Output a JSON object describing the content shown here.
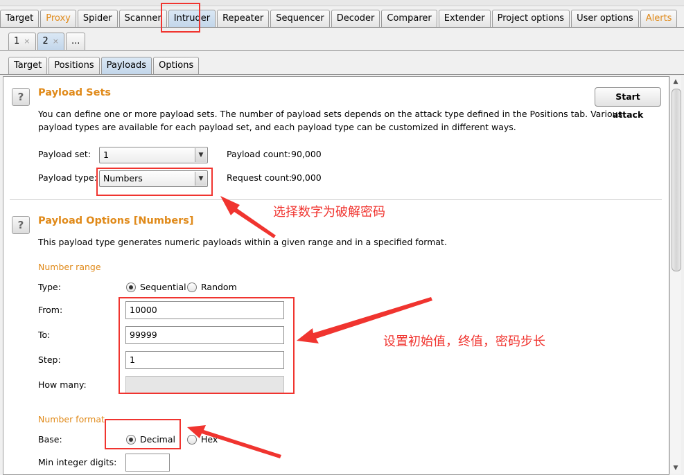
{
  "main_tabs": [
    "Target",
    "Proxy",
    "Spider",
    "Scanner",
    "Intruder",
    "Repeater",
    "Sequencer",
    "Decoder",
    "Comparer",
    "Extender",
    "Project options",
    "User options",
    "Alerts"
  ],
  "attack_tabs": [
    {
      "label": "1",
      "close": "×"
    },
    {
      "label": "2",
      "close": "×"
    },
    {
      "label": "..."
    }
  ],
  "intruder_tabs": [
    "Target",
    "Positions",
    "Payloads",
    "Options"
  ],
  "payload_sets": {
    "help": "?",
    "title": "Payload Sets",
    "start_attack": "Start attack",
    "desc1": "You can define one or more payload sets. The number of payload sets depends on the attack type defined in the Positions tab. Various",
    "desc2": "payload types are available for each payload set, and each payload type can be customized in different ways.",
    "set_label": "Payload set:",
    "set_value": "1",
    "count_label": "Payload count:",
    "count_value": "90,000",
    "type_label": "Payload type:",
    "type_value": "Numbers",
    "request_label": "Request count:",
    "request_value": "90,000"
  },
  "payload_options": {
    "help": "?",
    "title": "Payload Options [Numbers]",
    "desc": "This payload type generates numeric payloads within a given range and in a specified format.",
    "range_heading": "Number range",
    "type_label": "Type:",
    "sequential": "Sequential",
    "random": "Random",
    "from_label": "From:",
    "from_value": "10000",
    "to_label": "To:",
    "to_value": "99999",
    "step_label": "Step:",
    "step_value": "1",
    "howmany_label": "How many:",
    "format_heading": "Number format",
    "base_label": "Base:",
    "decimal": "Decimal",
    "hex": "Hex",
    "min_int_label": "Min integer digits:"
  },
  "annotations": {
    "choose_numbers": "选择数字为破解密码",
    "set_values": "设置初始值，终值，密码步长"
  },
  "scrollbar": {
    "up": "▲",
    "down": "▼"
  },
  "colors": {
    "accent_orange": "#e08a1a",
    "annotation_red": "#f0342f",
    "selected_tab": "#c3d6ea"
  }
}
